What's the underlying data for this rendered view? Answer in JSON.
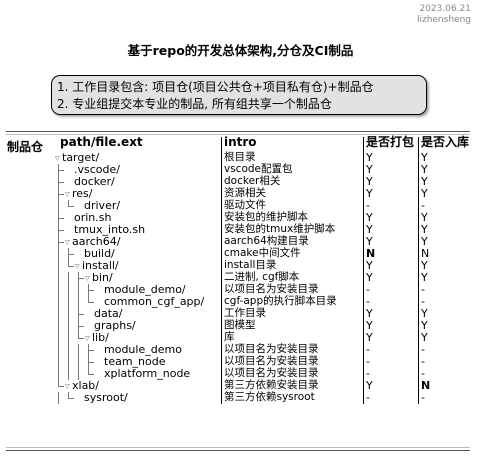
{
  "header": {
    "date": "2023.06.21",
    "author": "lizhensheng"
  },
  "title": "基于repo的开发总体架构,分仓及CI制品",
  "note": {
    "line1": "1. 工作目录包含: 项目仓(项目公共仓+项目私有仓)+制品仓",
    "line2": "2. 专业组提交本专业的制品, 所有组共享一个制品仓"
  },
  "side_label": "制品仓",
  "columns": [
    "path/file.ext",
    "intro",
    "是否打包",
    "是否入库"
  ],
  "rows": [
    {
      "name": "target/",
      "depth": 0,
      "folder": true,
      "intro": "根目录",
      "pack": "Y",
      "store": "Y"
    },
    {
      "name": ".vscode/",
      "depth": 1,
      "folder": false,
      "intro": "vscode配置包",
      "pack": "Y",
      "store": "Y"
    },
    {
      "name": "docker/",
      "depth": 1,
      "folder": false,
      "intro": "docker相关",
      "pack": "Y",
      "store": "Y"
    },
    {
      "name": "res/",
      "depth": 1,
      "folder": true,
      "intro": "资源相关",
      "pack": "Y",
      "store": "Y"
    },
    {
      "name": "driver/",
      "depth": 2,
      "folder": false,
      "intro": "驱动文件",
      "pack": "-",
      "store": "-"
    },
    {
      "name": "orin.sh",
      "depth": 1,
      "folder": false,
      "intro": "安装包的维护脚本",
      "pack": "Y",
      "store": "Y"
    },
    {
      "name": "tmux_into.sh",
      "depth": 1,
      "folder": false,
      "intro": "安装包的tmux维护脚本",
      "pack": "Y",
      "store": "Y"
    },
    {
      "name": "aarch64/",
      "depth": 1,
      "folder": true,
      "intro": "aarch64构建目录",
      "pack": "Y",
      "store": "Y"
    },
    {
      "name": "build/",
      "depth": 2,
      "folder": false,
      "intro": "cmake中间文件",
      "pack": "N",
      "store": "N",
      "pack_bold": true
    },
    {
      "name": "install/",
      "depth": 2,
      "folder": true,
      "intro": "install目录",
      "pack": "Y",
      "store": "Y"
    },
    {
      "name": "bin/",
      "depth": 3,
      "folder": true,
      "intro": "二进制, cgf脚本",
      "pack": "Y",
      "store": "Y"
    },
    {
      "name": "module_demo/",
      "depth": 4,
      "folder": false,
      "intro": "以项目名为安装目录",
      "pack": "-",
      "store": "-"
    },
    {
      "name": "common_cgf_app/",
      "depth": 4,
      "folder": false,
      "intro": "cgf-app的执行脚本目录",
      "pack": "-",
      "store": "-"
    },
    {
      "name": "data/",
      "depth": 3,
      "folder": false,
      "intro": "工作目录",
      "pack": "Y",
      "store": "Y"
    },
    {
      "name": "graphs/",
      "depth": 3,
      "folder": false,
      "intro": "图模型",
      "pack": "Y",
      "store": "Y"
    },
    {
      "name": "lib/",
      "depth": 3,
      "folder": true,
      "intro": "库",
      "pack": "Y",
      "store": "Y"
    },
    {
      "name": "module_demo",
      "depth": 4,
      "folder": false,
      "intro": "以项目名为安装目录",
      "pack": "-",
      "store": "-"
    },
    {
      "name": "team_node",
      "depth": 4,
      "folder": false,
      "intro": "以项目名为安装目录",
      "pack": "-",
      "store": "-"
    },
    {
      "name": "xplatform_node",
      "depth": 4,
      "folder": false,
      "intro": "以项目名为安装目录",
      "pack": "-",
      "store": "-"
    },
    {
      "name": "xlab/",
      "depth": 1,
      "folder": true,
      "intro": "第三方依赖安装目录",
      "pack": "Y",
      "store": "N",
      "store_bold": true
    },
    {
      "name": "sysroot/",
      "depth": 2,
      "folder": false,
      "intro": "第三方依赖sysroot",
      "pack": "-",
      "store": "-"
    }
  ]
}
